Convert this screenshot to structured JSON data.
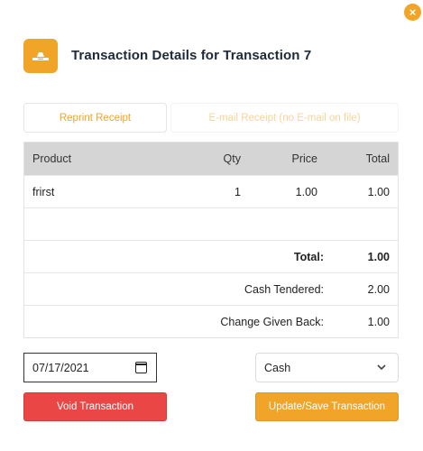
{
  "colors": {
    "accent": "#f0a529",
    "danger": "#eb4646"
  },
  "header": {
    "title": "Transaction Details for Transaction 7",
    "icon": "receipt-icon"
  },
  "close": {
    "icon": "close-icon",
    "glyph": "×"
  },
  "actions": {
    "reprint_label": "Reprint Receipt",
    "email_label": "E-mail Receipt (no E-mail on file)"
  },
  "table": {
    "columns": {
      "product": "Product",
      "qty": "Qty",
      "price": "Price",
      "total": "Total"
    },
    "items": [
      {
        "product": "frirst",
        "qty": "1",
        "price": "1.00",
        "total": "1.00"
      }
    ],
    "summary": {
      "total_label": "Total:",
      "total_value": "1.00",
      "tendered_label": "Cash Tendered:",
      "tendered_value": "2.00",
      "change_label": "Change Given Back:",
      "change_value": "1.00"
    }
  },
  "form": {
    "date_value": "07/17/2021",
    "payment_method": "Cash"
  },
  "footer": {
    "void_label": "Void Transaction",
    "save_label": "Update/Save Transaction"
  }
}
